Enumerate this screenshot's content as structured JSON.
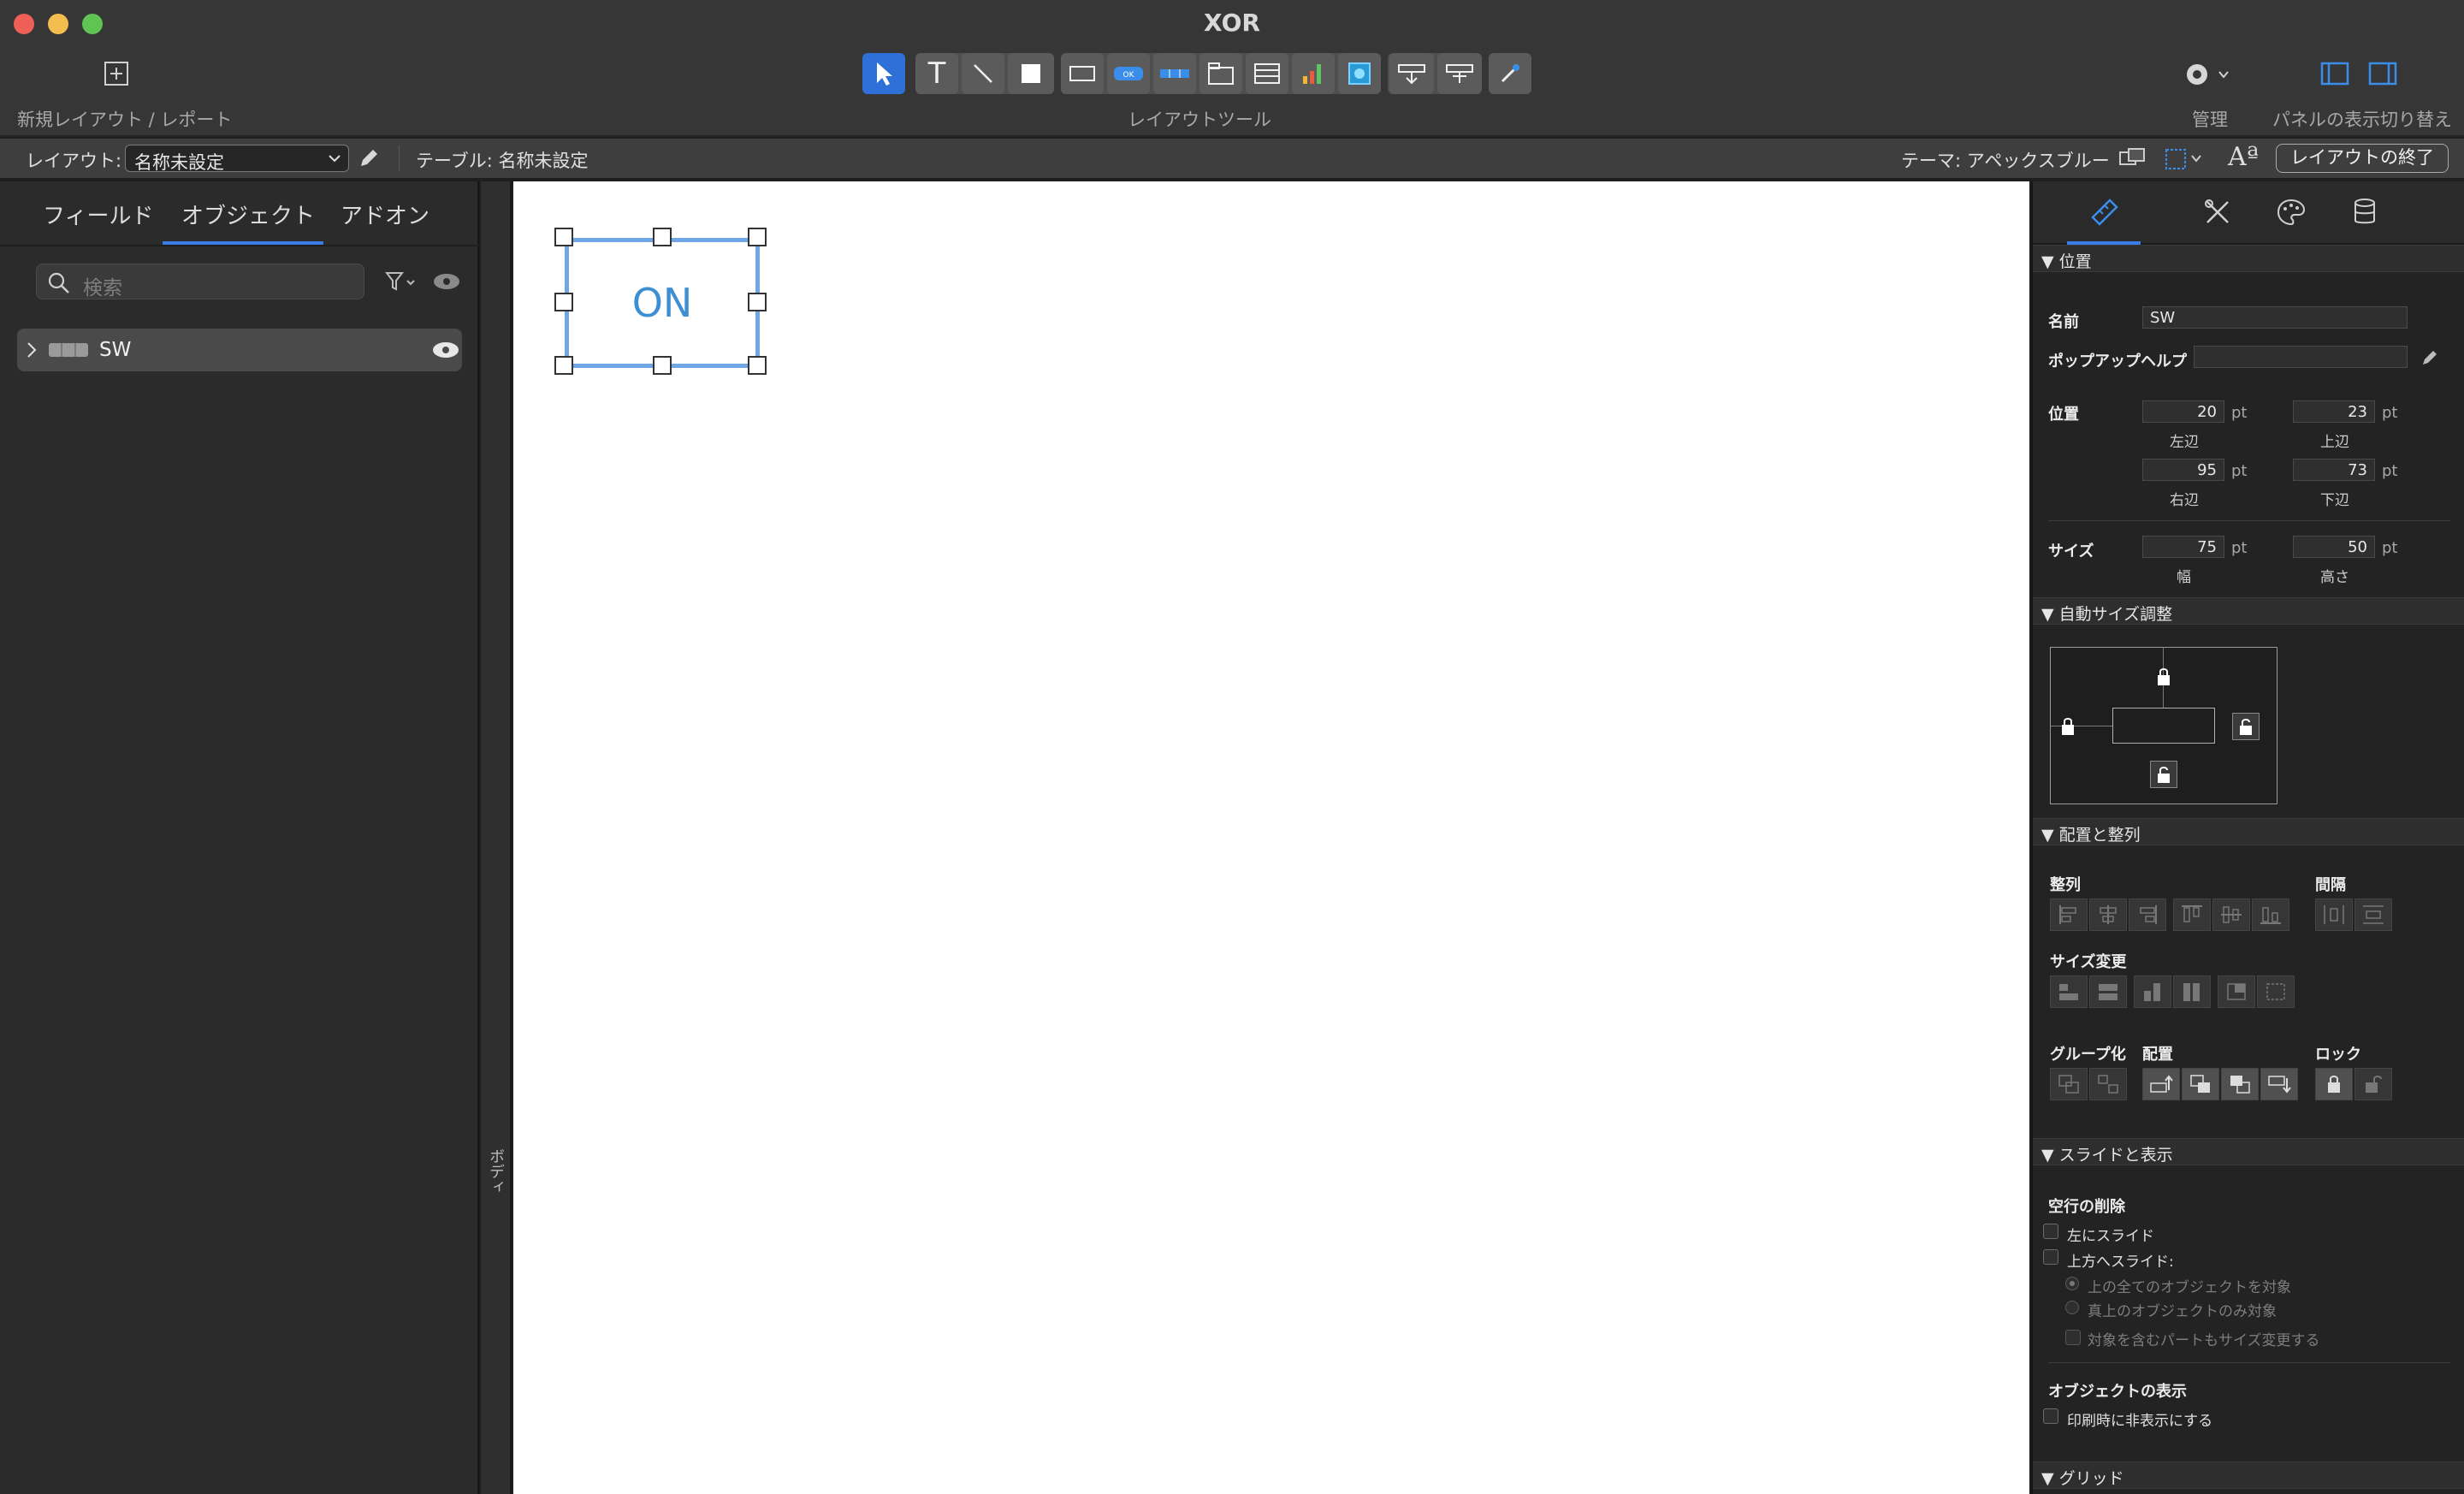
{
  "window": {
    "title": "XOR"
  },
  "toolbar": {
    "new_layout_label": "新規レイアウト / レポート",
    "layout_tools_label": "レイアウトツール",
    "manage_label": "管理",
    "panel_toggle_label": "パネルの表示切り替え"
  },
  "layout_bar": {
    "layout_label": "レイアウト:",
    "layout_value": "名称未設定",
    "table_label": "テーブル: 名称未設定",
    "theme_label": "テーマ: アペックスブルー",
    "exit_button": "レイアウトの終了"
  },
  "left_panel": {
    "tabs": [
      "フィールド",
      "オブジェクト",
      "アドオン"
    ],
    "active_tab": "オブジェクト",
    "search_placeholder": "検索",
    "objects": [
      {
        "name": "SW"
      }
    ]
  },
  "canvas": {
    "part_label": "ボディ",
    "object_text": "ON"
  },
  "inspector": {
    "position_section": "▼ 位置",
    "name_label": "名前",
    "name_value": "SW",
    "popup_help_label": "ポップアップヘルプ",
    "popup_help_value": "",
    "position_label": "位置",
    "left": "20",
    "left_label": "左辺",
    "top": "23",
    "top_label": "上辺",
    "right": "95",
    "right_label": "右辺",
    "bottom": "73",
    "bottom_label": "下辺",
    "unit": "pt",
    "size_label": "サイズ",
    "width": "75",
    "width_label": "幅",
    "height": "50",
    "height_label": "高さ",
    "autosize_section": "▼ 自動サイズ調整",
    "arrange_section": "▼ 配置と整列",
    "align_label": "整列",
    "spacing_label": "間隔",
    "resize_label": "サイズ変更",
    "group_label": "グループ化",
    "arrange_label": "配置",
    "lock_label": "ロック",
    "slide_section": "▼ スライドと表示",
    "remove_blank_label": "空行の削除",
    "slide_left": "左にスライド",
    "slide_up": "上方へスライド:",
    "radio_all_above": "上の全てのオブジェクトを対象",
    "radio_directly_above": "真上のオブジェクトのみ対象",
    "resize_enclosing": "対象を含むパートもサイズ変更する",
    "object_visibility_label": "オブジェクトの表示",
    "hide_when_printing": "印刷時に非表示にする",
    "grid_section": "▼ グリッド"
  },
  "colors": {
    "accent": "#2f6fd8",
    "selection_border": "#6fa6e6",
    "on_text": "#3d8ed2",
    "close": "#ee5f57",
    "minimize": "#f5bd4f",
    "zoom": "#5fc454"
  }
}
